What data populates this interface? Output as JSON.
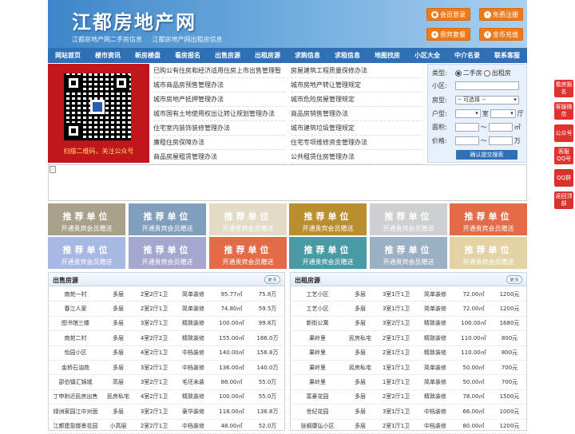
{
  "header": {
    "logo": "江都房地产网",
    "sub1": "江都房地产网二手房信息",
    "sub2": "江都房地产网出租房信息",
    "buttons": [
      {
        "label": "会员登录",
        "icon": "user-icon"
      },
      {
        "label": "免费注册",
        "icon": "register-icon"
      },
      {
        "label": "贵宾套餐",
        "icon": "gift-icon"
      },
      {
        "label": "金币充值",
        "icon": "coin-icon"
      }
    ]
  },
  "nav": [
    "网站首页",
    "楼市资讯",
    "新房楼盘",
    "看房报名",
    "出售房源",
    "出租房源",
    "求购信息",
    "求租信息",
    "地图找房",
    "小区大全",
    "中介名录",
    "联系客服"
  ],
  "qr": {
    "caption": "扫描二维码，关注公众号"
  },
  "links_left": [
    "已购公有住房和经济适用住房上市出售管理暂",
    "城市商品房预售管理办法",
    "城市房地产抵押管理办法",
    "城市国有土地使用权出让转让规划管理办法",
    "住宅室内装饰装修管理办法",
    "廉租住房保障办法",
    "商品房屋租赁管理办法"
  ],
  "links_right": [
    "房屋建筑工程质量保修办法",
    "城市房地产转让管理规定",
    "城市危险房屋管理规定",
    "商品房销售管理办法",
    "城市建筑垃圾管理规定",
    "住宅专项维修资金管理办法",
    "公共租赁住房管理办法"
  ],
  "search": {
    "type_label": "类型:",
    "opt1": "二手房",
    "opt2": "出租房",
    "community_label": "小区:",
    "housetype_label": "房型:",
    "housetype_value": "-- 可选择 --",
    "layout_label": "户型:",
    "room": "室",
    "hall": "厅",
    "area_label": "面积:",
    "area_unit": "㎡",
    "range_sep": "～",
    "price_label": "价格:",
    "price_unit": "万",
    "submit": "确认提交搜索"
  },
  "ads": {
    "title": "推荐单位",
    "sub": "开通贵宾会员赠送",
    "colors": [
      "#a9a089",
      "#7f9fbd",
      "#e3dbc6",
      "#b98e2e",
      "#cdcfd0",
      "#e46b48",
      "#a6b8e3",
      "#a6a7cf",
      "#e46b48",
      "#4a9aa6",
      "#9bb0c4",
      "#e3d3a4"
    ]
  },
  "sale": {
    "title": "出售房源",
    "more": "更多",
    "rows": [
      [
        "南苑一村",
        "多层",
        "2室2厅1卫",
        "简单装修",
        "95.77㎡",
        "75.8万"
      ],
      [
        "春江人家",
        "多层",
        "2室2厅1卫",
        "简单装修",
        "74.80㎡",
        "59.5万"
      ],
      [
        "图书馆三楼",
        "多层",
        "3室2厅1卫",
        "精致装修",
        "100.00㎡",
        "99.8万"
      ],
      [
        "南苑二村",
        "多层",
        "4室2厅2卫",
        "精致装修",
        "155.00㎡",
        "186.0万"
      ],
      [
        "怡园小区",
        "多层",
        "4室2厅1卫",
        "中档装修",
        "140.00㎡",
        "156.8万"
      ],
      [
        "金桥石油苑",
        "多层",
        "3室2厅1卫",
        "中档装修",
        "136.00㎡",
        "140.0万"
      ],
      [
        "邵伯镇汇锦城",
        "高层",
        "3室2厅1卫",
        "毛坯未装",
        "88.00㎡",
        "55.0万"
      ],
      [
        "丁申附近民房出售",
        "民房私宅",
        "4室2厅1卫",
        "精致装修",
        "100.00㎡",
        "55.0万"
      ],
      [
        "绿洲家园江中对面",
        "多层",
        "3室2厅1卫",
        "豪华装修",
        "118.00㎡",
        "136.8万"
      ],
      [
        "江都建盈御景花园",
        "小高层",
        "2室2厅1卫",
        "中档装修",
        "48.00㎡",
        "52.0万"
      ]
    ]
  },
  "rent": {
    "title": "出租房源",
    "more": "更多",
    "rows": [
      [
        "工艺小区",
        "多层",
        "3室1厅1卫",
        "简单装修",
        "72.00㎡",
        "1200元"
      ],
      [
        "工艺小区",
        "多层",
        "3室1厅1卫",
        "简单装修",
        "72.00㎡",
        "1200元"
      ],
      [
        "新街公寓",
        "多层",
        "3室2厅1卫",
        "精致装修",
        "100.00㎡",
        "1680元"
      ],
      [
        "果岭里",
        "民房私宅",
        "2室1厅1卫",
        "精致装修",
        "110.00㎡",
        "800元"
      ],
      [
        "果岭里",
        "多层",
        "2室1厅1卫",
        "精致装修",
        "110.00㎡",
        "800元"
      ],
      [
        "果岭里",
        "民房私宅",
        "1室1厅1卫",
        "简单装修",
        "50.00㎡",
        "700元"
      ],
      [
        "果岭里",
        "多层",
        "1室1厅1卫",
        "简单装修",
        "50.00㎡",
        "700元"
      ],
      [
        "富豪花园",
        "多层",
        "2室2厅1卫",
        "精致装修",
        "78.00㎡",
        "1500元"
      ],
      [
        "世纪花园",
        "多层",
        "3室1厅1卫",
        "中档装修",
        "66.00㎡",
        "1000元"
      ],
      [
        "张纲康弘小区",
        "多层",
        "2室1厅1卫",
        "中档装修",
        "80.00㎡",
        "1200元"
      ]
    ]
  },
  "sidebar": [
    "看房报名",
    "客服微信",
    "公众号",
    "客服QQ号",
    "QQ群",
    "返回顶部"
  ]
}
